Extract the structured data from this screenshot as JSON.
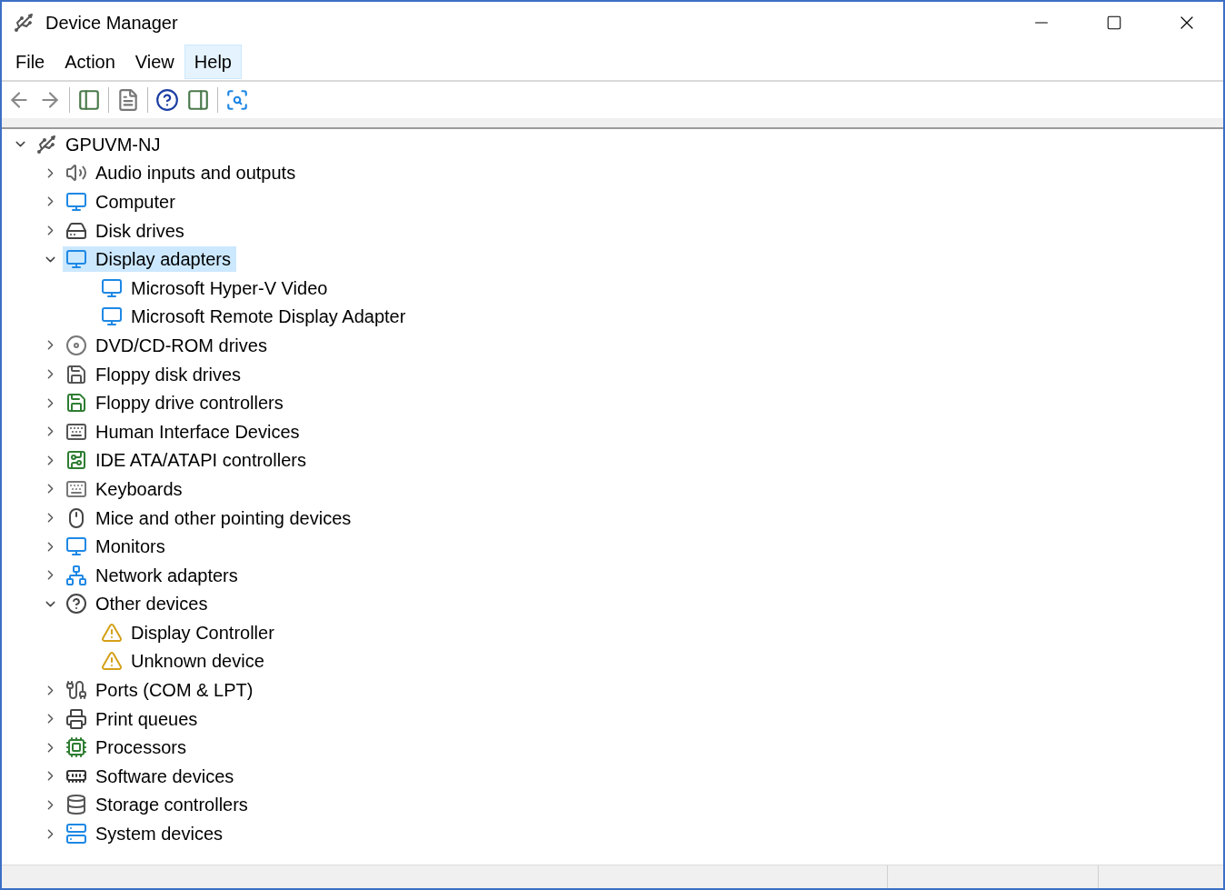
{
  "window": {
    "title": "Device Manager"
  },
  "menu": [
    {
      "label": "File",
      "highlighted": false
    },
    {
      "label": "Action",
      "highlighted": false
    },
    {
      "label": "View",
      "highlighted": false
    },
    {
      "label": "Help",
      "highlighted": true
    }
  ],
  "tree": {
    "label": "GPUVM-NJ",
    "expanded": true,
    "selected": false,
    "children": [
      {
        "label": "Audio inputs and outputs",
        "expanded": false,
        "selected": false
      },
      {
        "label": "Computer",
        "expanded": false,
        "selected": false
      },
      {
        "label": "Disk drives",
        "expanded": false,
        "selected": false
      },
      {
        "label": "Display adapters",
        "expanded": true,
        "selected": true,
        "children": [
          {
            "label": "Microsoft Hyper-V Video",
            "selected": false
          },
          {
            "label": "Microsoft Remote Display Adapter",
            "selected": false
          }
        ]
      },
      {
        "label": "DVD/CD-ROM drives",
        "expanded": false,
        "selected": false
      },
      {
        "label": "Floppy disk drives",
        "expanded": false,
        "selected": false
      },
      {
        "label": "Floppy drive controllers",
        "expanded": false,
        "selected": false
      },
      {
        "label": "Human Interface Devices",
        "expanded": false,
        "selected": false
      },
      {
        "label": "IDE ATA/ATAPI controllers",
        "expanded": false,
        "selected": false
      },
      {
        "label": "Keyboards",
        "expanded": false,
        "selected": false
      },
      {
        "label": "Mice and other pointing devices",
        "expanded": false,
        "selected": false
      },
      {
        "label": "Monitors",
        "expanded": false,
        "selected": false
      },
      {
        "label": "Network adapters",
        "expanded": false,
        "selected": false
      },
      {
        "label": "Other devices",
        "expanded": true,
        "selected": false,
        "children": [
          {
            "label": "Display Controller",
            "selected": false
          },
          {
            "label": "Unknown device",
            "selected": false
          }
        ]
      },
      {
        "label": "Ports (COM & LPT)",
        "expanded": false,
        "selected": false
      },
      {
        "label": "Print queues",
        "expanded": false,
        "selected": false
      },
      {
        "label": "Processors",
        "expanded": false,
        "selected": false
      },
      {
        "label": "Software devices",
        "expanded": false,
        "selected": false
      },
      {
        "label": "Storage controllers",
        "expanded": false,
        "selected": false
      },
      {
        "label": "System devices",
        "expanded": false,
        "selected": false
      }
    ]
  }
}
